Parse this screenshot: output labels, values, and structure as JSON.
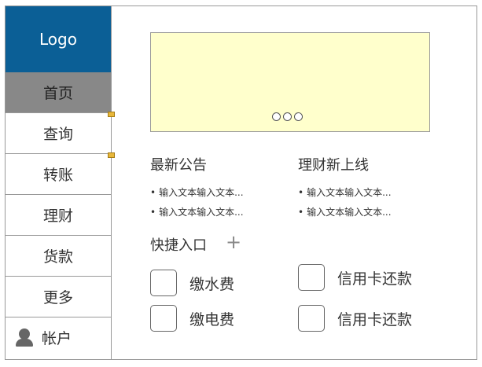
{
  "sidebar": {
    "logo": "Logo",
    "items": [
      {
        "label": "首页"
      },
      {
        "label": "查询"
      },
      {
        "label": "转账"
      },
      {
        "label": "理财"
      },
      {
        "label": "货款"
      },
      {
        "label": "更多"
      }
    ],
    "account": {
      "label": "帐户",
      "icon": "user-icon"
    }
  },
  "banner": {
    "indicator_count": 3
  },
  "announcements": {
    "title": "最新公告",
    "items": [
      "输入文本输入文本...",
      "输入文本输入文本..."
    ]
  },
  "new_products": {
    "title": "理财新上线",
    "items": [
      "输入文本输入文本...",
      "输入文本输入文本..."
    ]
  },
  "quick_entry": {
    "title": "快捷入口",
    "add_symbol": "+",
    "items": [
      {
        "label": "缴水费"
      },
      {
        "label": "信用卡还款"
      },
      {
        "label": "缴电费"
      },
      {
        "label": "信用卡还款"
      }
    ]
  },
  "colors": {
    "logo_bg": "#0b5f96",
    "active_nav_bg": "#888888",
    "banner_bg": "#ffffcc"
  }
}
